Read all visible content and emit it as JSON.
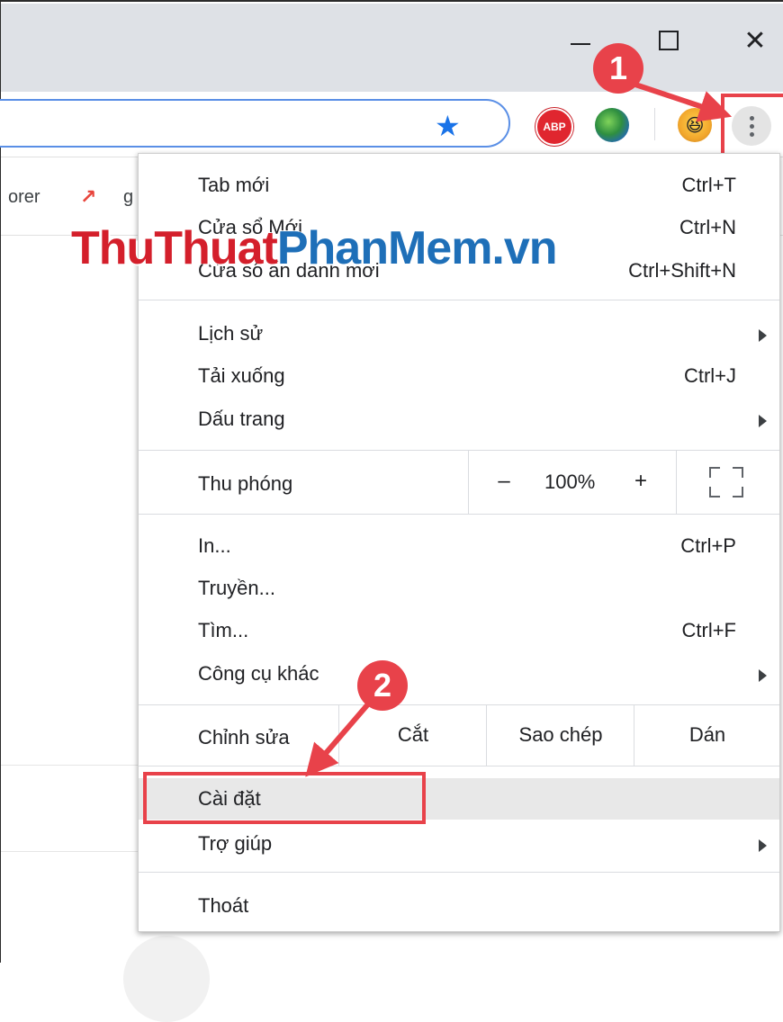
{
  "window": {
    "minimize_icon": "minimize-icon",
    "maximize_icon": "maximize-icon",
    "close_icon": "close-icon",
    "close_glyph": "✕"
  },
  "toolbar": {
    "bookmark_star_glyph": "★",
    "abp_label": "ABP",
    "avatar_glyph": "😆",
    "menu_icon": "three-dots-vertical-icon"
  },
  "bookmarks_bar": {
    "item1": "orer",
    "item2": "g"
  },
  "watermark": {
    "part1": "ThuThuat",
    "part2": "PhanMem.vn"
  },
  "menu": {
    "new_tab": {
      "label": "Tab mới",
      "shortcut": "Ctrl+T"
    },
    "new_window": {
      "label": "Cửa sổ Mới",
      "shortcut": "Ctrl+N"
    },
    "incognito": {
      "label": "Cửa sổ ẩn danh mới",
      "shortcut": "Ctrl+Shift+N"
    },
    "history": {
      "label": "Lịch sử"
    },
    "downloads": {
      "label": "Tải xuống",
      "shortcut": "Ctrl+J"
    },
    "bookmarks": {
      "label": "Dấu trang"
    },
    "zoom": {
      "label": "Thu phóng",
      "minus": "–",
      "value": "100%",
      "plus": "+"
    },
    "print": {
      "label": "In...",
      "shortcut": "Ctrl+P"
    },
    "cast": {
      "label": "Truyền..."
    },
    "find": {
      "label": "Tìm...",
      "shortcut": "Ctrl+F"
    },
    "more_tools": {
      "label": "Công cụ khác"
    },
    "edit": {
      "label": "Chỉnh sửa",
      "cut": "Cắt",
      "copy": "Sao chép",
      "paste": "Dán"
    },
    "settings": {
      "label": "Cài đặt"
    },
    "help": {
      "label": "Trợ giúp"
    },
    "exit": {
      "label": "Thoát"
    }
  },
  "annotations": {
    "step1": "1",
    "step2": "2",
    "color": "#e8424a"
  },
  "colors": {
    "titlebar": "#dee1e6",
    "omnibox_border": "#5a8fe6",
    "star": "#1a73e8",
    "hover_row": "#e8e8e8"
  }
}
